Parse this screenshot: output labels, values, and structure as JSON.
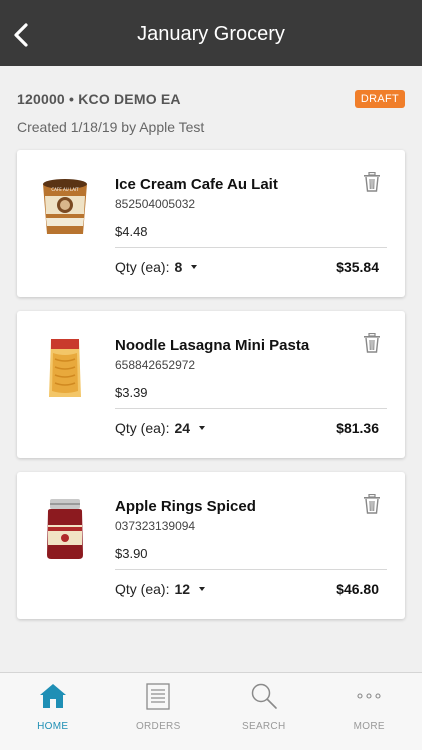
{
  "header": {
    "title": "January Grocery",
    "back_icon": "chevron-left-icon"
  },
  "order": {
    "account": "120000 • KCO DEMO EA",
    "status": "DRAFT",
    "created": "Created 1/18/19 by Apple Test"
  },
  "items": [
    {
      "name": "Ice Cream Cafe Au Lait",
      "sku": "852504005032",
      "price": "$4.48",
      "qty_label": "Qty (ea):",
      "qty": "8",
      "total": "$35.84",
      "image": "ice-cream-pint-image"
    },
    {
      "name": "Noodle Lasagna Mini Pasta",
      "sku": "658842652972",
      "price": "$3.39",
      "qty_label": "Qty (ea):",
      "qty": "24",
      "total": "$81.36",
      "image": "pasta-bag-image"
    },
    {
      "name": "Apple Rings Spiced",
      "sku": "037323139094",
      "price": "$3.90",
      "qty_label": "Qty (ea):",
      "qty": "12",
      "total": "$46.80",
      "image": "apple-rings-jar-image"
    }
  ],
  "tabs": [
    {
      "label": "HOME",
      "icon": "home-icon",
      "active": true
    },
    {
      "label": "ORDERS",
      "icon": "orders-icon",
      "active": false
    },
    {
      "label": "SEARCH",
      "icon": "search-icon",
      "active": false
    },
    {
      "label": "MORE",
      "icon": "more-icon",
      "active": false
    }
  ],
  "colors": {
    "header": "#3a3a3a",
    "badge": "#f07e2a",
    "accent": "#1f8fb5"
  }
}
